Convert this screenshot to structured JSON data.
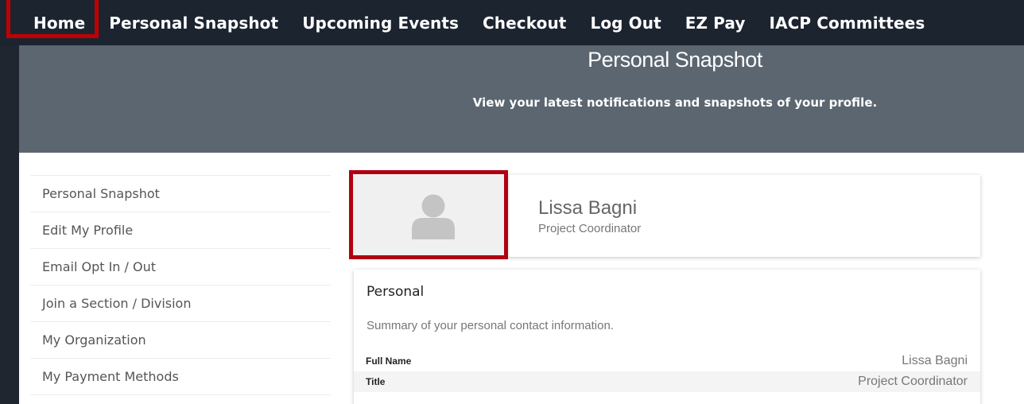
{
  "nav": {
    "items": [
      "Home",
      "Personal Snapshot",
      "Upcoming Events",
      "Checkout",
      "Log Out",
      "EZ Pay",
      "IACP Committees"
    ]
  },
  "hero": {
    "title": "Personal Snapshot",
    "subtitle": "View your latest notifications and snapshots of your profile."
  },
  "sidebar": {
    "items": [
      "Personal Snapshot",
      "Edit My Profile",
      "Email Opt In / Out",
      "Join a Section / Division",
      "My Organization",
      "My Payment Methods"
    ]
  },
  "profile": {
    "avatar_icon": "user-silhouette-icon",
    "name": "Lissa Bagni",
    "role": "Project Coordinator"
  },
  "personal": {
    "title": "Personal",
    "description": "Summary of your personal contact information.",
    "rows": [
      {
        "label": "Full Name",
        "value": "Lissa Bagni"
      },
      {
        "label": "Title",
        "value": "Project Coordinator"
      }
    ]
  },
  "colors": {
    "nav_bg": "#1c2430",
    "hero_bg": "#5b6670",
    "highlight": "#c00000"
  }
}
